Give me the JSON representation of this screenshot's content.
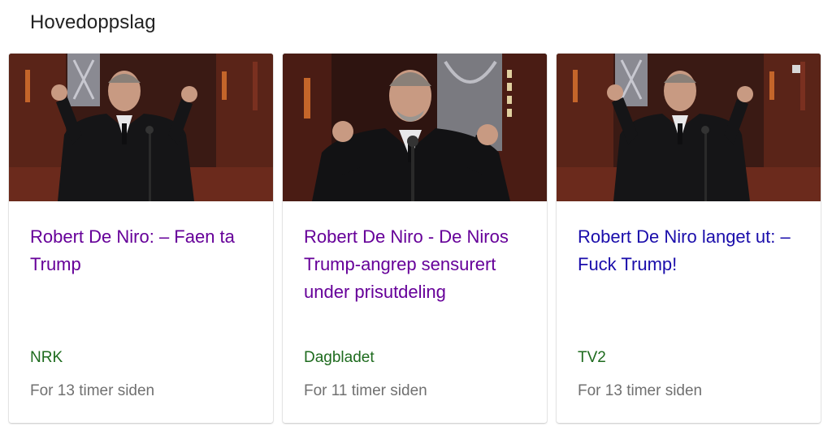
{
  "section": {
    "title": "Hovedoppslag"
  },
  "cards": [
    {
      "headline": "Robert De Niro: – Faen ta Trump",
      "source": "NRK",
      "time": "For 13 timer siden",
      "visited": true
    },
    {
      "headline": "Robert De Niro - De Niros Trump-angrep sensurert under prisutdeling",
      "source": "Dagbladet",
      "time": "For 11 timer siden",
      "visited": true
    },
    {
      "headline": "Robert De Niro langet ut: – Fuck Trump!",
      "source": "TV2",
      "time": "For 13 timer siden",
      "visited": false
    }
  ],
  "colors": {
    "visited_link": "#660099",
    "unvisited_link": "#1a0dab",
    "source": "#1e6b1e",
    "time": "#707070"
  }
}
